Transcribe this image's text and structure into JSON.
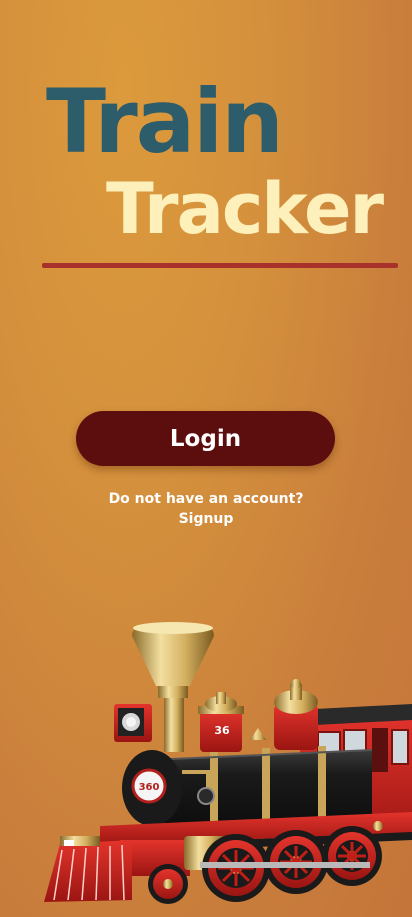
{
  "app": {
    "title_line1": "Train",
    "title_line2": "Tracker"
  },
  "auth": {
    "login_label": "Login",
    "signup_prompt": "Do not have an account?",
    "signup_label": "Signup"
  },
  "illustration": {
    "locomotive_number": "360",
    "dome_number": "36"
  },
  "colors": {
    "background": "#d4903c",
    "title_train": "#2d5c6b",
    "title_tracker": "#fdf0ba",
    "divider": "#a8312b",
    "button": "#5c0d0e",
    "button_text": "#ffffff"
  }
}
